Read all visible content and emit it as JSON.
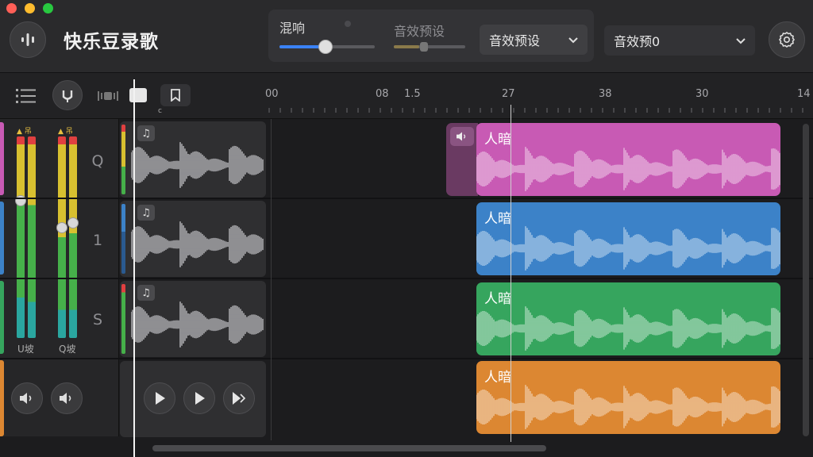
{
  "app": {
    "title": "快乐豆录歌"
  },
  "window_controls": [
    "close",
    "minimize",
    "maximize"
  ],
  "effects": {
    "reverb_label": "混响",
    "reverb_level": 0.5,
    "preset_label": "音效预设",
    "preset_level": 0.35,
    "preset_select": "音效预设",
    "preset_dropdown": "音效预0"
  },
  "ruler": {
    "ticks": [
      "00",
      "08",
      "1.5",
      "27",
      "38",
      "30",
      "14"
    ]
  },
  "tracks": [
    {
      "number": "Q",
      "color": "#c85ab4",
      "clip_label": "人暗"
    },
    {
      "number": "1",
      "color": "#3c82c8",
      "clip_label": "人暗"
    },
    {
      "number": "S",
      "color": "#36a55e",
      "clip_label": "人暗"
    },
    {
      "number": "",
      "color": "#dc8732",
      "clip_label": "人暗"
    }
  ],
  "mixer": {
    "channel_a_label": "U坡",
    "channel_b_label": "Q坡"
  },
  "icons": {
    "app": "waveform-icon",
    "settings": "gear-icon",
    "list": "list-icon",
    "tuning": "tuning-fork-icon",
    "mirror": "split-icon",
    "note": "music-note-icon",
    "volume": "speaker-icon",
    "play": "play-icon",
    "skip": "skip-icon"
  }
}
